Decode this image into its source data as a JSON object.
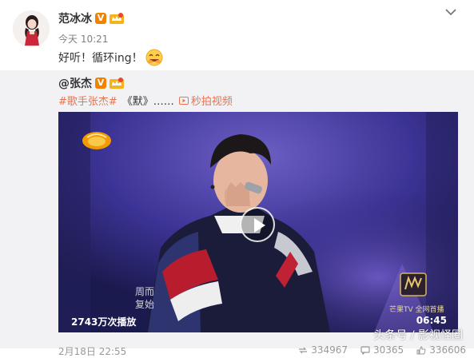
{
  "post": {
    "author": "范冰冰",
    "time": "今天 10:21",
    "text": "好听！循环ing！"
  },
  "repost": {
    "author": "@张杰",
    "tag": "#歌手张杰#",
    "text": "《默》……",
    "video_link": "秒拍视频"
  },
  "video": {
    "subtitle_line1": "周而",
    "subtitle_line2": "复始",
    "brand": "芒果TV 全网首播",
    "play_count": "2743万次播放",
    "duration": "06:45"
  },
  "footer": {
    "date": "2月18日 22:55",
    "reposts": "334967",
    "comments": "30365",
    "likes": "336606"
  },
  "watermark": "头条号 / 影视怪圈",
  "colors": {
    "accent": "#eb7350",
    "verified": "#f08200",
    "repost_bg": "#f2f2f5"
  },
  "icons": [
    "avatar",
    "verified-v-icon",
    "crown-badge-icon",
    "chevron-down-icon",
    "smile-emoji-icon",
    "video-play-icon",
    "hunan-tv-logo",
    "repost-icon",
    "comment-icon",
    "like-icon"
  ]
}
